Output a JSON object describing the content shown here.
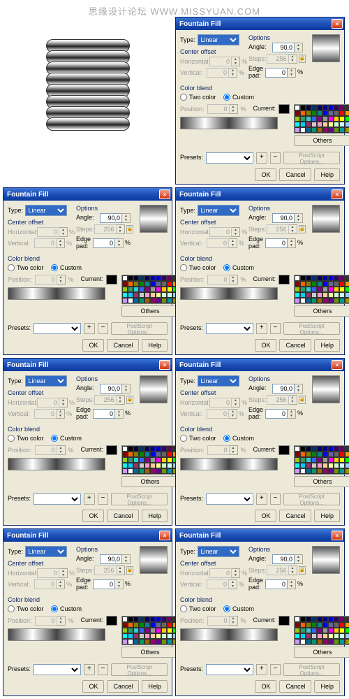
{
  "watermark": "思缘设计论坛   WWW.MISSYUAN.COM",
  "dialog": {
    "title": "Fountain Fill",
    "type_label": "Type:",
    "type_value": "Linear",
    "center_offset": "Center offset",
    "horizontal": "Horizontal:",
    "vertical": "Vertical:",
    "options": "Options",
    "angle": "Angle:",
    "angle_val": "90,0",
    "steps": "Steps:",
    "steps_val": "256",
    "edge_pad": "Edge pad:",
    "edge_val": "0",
    "percent": "%",
    "color_blend": "Color blend",
    "two_color": "Two color",
    "custom": "Custom",
    "position": "Position:",
    "pos_val": "0",
    "current": "Current:",
    "others": "Others",
    "presets": "Presets:",
    "postscript": "PostScript Options...",
    "ok": "OK",
    "cancel": "Cancel",
    "help": "Help",
    "zero": "0"
  },
  "palette_colors": [
    "#fff",
    "#000",
    "#003",
    "#036",
    "#006",
    "#009",
    "#00c",
    "#306",
    "#606",
    "#333",
    "#800",
    "#f60",
    "#808000",
    "#080",
    "#088",
    "#00f",
    "#669",
    "#666",
    "#f00",
    "#f90",
    "#9c0",
    "#396",
    "#3cc",
    "#36f",
    "#808",
    "#999",
    "#f0f",
    "#fc0",
    "#ff0",
    "#0f0",
    "#0ff",
    "#0cf",
    "#936",
    "#ccc",
    "#f9c",
    "#fc9",
    "#ff9",
    "#cfc",
    "#cff",
    "#9cf",
    "#c9f",
    "#fff",
    "#069",
    "#096",
    "#960",
    "#906",
    "#609",
    "#690",
    "#099",
    "#990"
  ]
}
